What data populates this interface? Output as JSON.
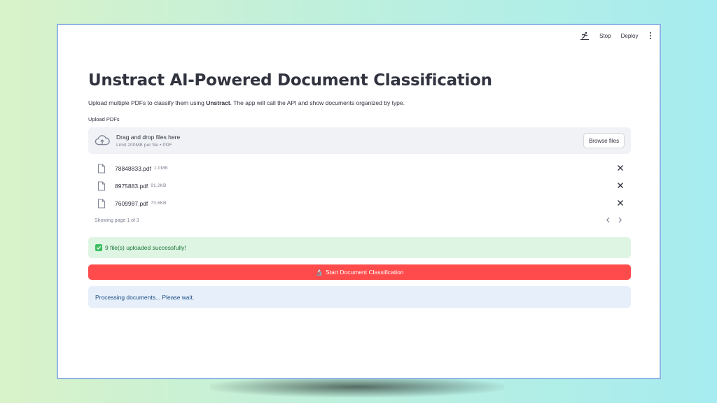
{
  "topbar": {
    "stop_label": "Stop",
    "deploy_label": "Deploy",
    "running_icon": "running-person-icon",
    "menu_icon": "kebab-menu-icon"
  },
  "main": {
    "title": "Unstract AI-Powered Document Classification",
    "description_prefix": "Upload multiple PDFs to classify them using ",
    "description_bold": "Unstract",
    "description_suffix": ". The app will call the API and show documents organized by type."
  },
  "uploader": {
    "label": "Upload PDFs",
    "drop_text": "Drag and drop files here",
    "limit_text": "Limit 200MB per file • PDF",
    "browse_label": "Browse files",
    "files": [
      {
        "name": "78848833.pdf",
        "size": "1.0MB"
      },
      {
        "name": "8975883.pdf",
        "size": "91.2KB"
      },
      {
        "name": "7609987.pdf",
        "size": "73.6KB"
      }
    ],
    "pagination": "Showing page 1 of 3"
  },
  "status": {
    "success_text": "9 file(s) uploaded successfully!",
    "start_button_label": "Start Document Classification",
    "start_button_icon": "🔬",
    "info_text": "Processing documents... Please wait."
  },
  "colors": {
    "primary": "#ff4b4b",
    "success_bg": "#dff5e4",
    "success_text": "#177233",
    "info_bg": "#e6effa",
    "info_text": "#1c4f85"
  }
}
